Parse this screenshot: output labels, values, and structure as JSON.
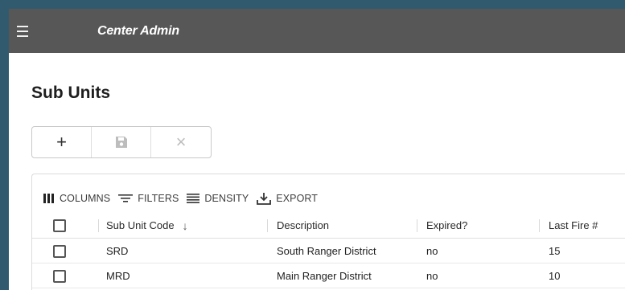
{
  "appbar": {
    "title": "Center Admin"
  },
  "page": {
    "title": "Sub Units"
  },
  "toolbar": {
    "add": "+",
    "save_icon": "save-icon",
    "cancel": "×"
  },
  "grid_toolbar": {
    "columns": "COLUMNS",
    "filters": "FILTERS",
    "density": "DENSITY",
    "export": "EXPORT"
  },
  "table": {
    "headers": [
      "Sub Unit Code",
      "Description",
      "Expired?",
      "Last Fire #"
    ],
    "sort_indicator": "↓",
    "rows": [
      {
        "code": "SRD",
        "description": "South Ranger District",
        "expired": "no",
        "last_fire": "15"
      },
      {
        "code": "MRD",
        "description": "Main Ranger District",
        "expired": "no",
        "last_fire": "10"
      }
    ]
  },
  "colors": {
    "appbar": "#575757",
    "background": "#315a6e"
  }
}
